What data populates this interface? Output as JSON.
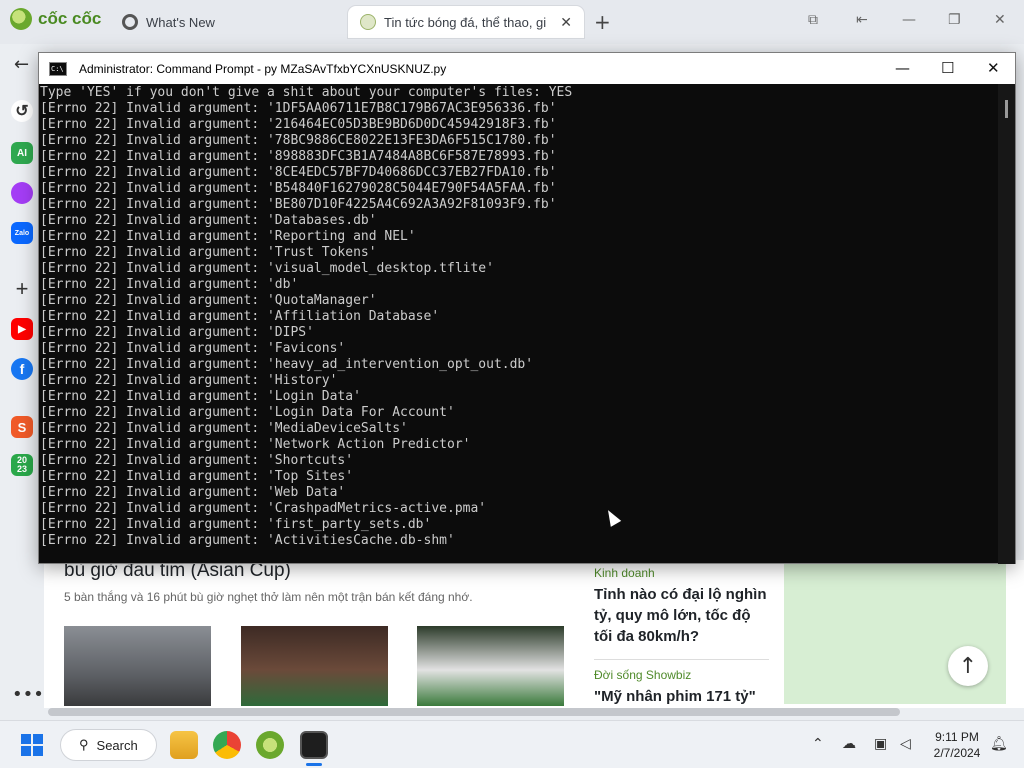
{
  "browser": {
    "logo_text": "cốc cốc",
    "tabs": [
      {
        "label": "What's New"
      },
      {
        "label": "Tin tức bóng đá, thể thao, gi"
      }
    ]
  },
  "page": {
    "headline": "bù giờ đau tim (Asian Cup)",
    "summary": "5 bàn thắng và 16 phút bù giờ nghẹt thở làm nên một trận bán kết đáng nhớ.",
    "right": [
      {
        "category": "Kinh doanh",
        "title": "Tỉnh nào có đại lộ nghìn tỷ, quy mô lớn, tốc độ tối đa 80km/h?"
      },
      {
        "category": "Đời sống Showbiz",
        "title": "\"Mỹ nhân phim 171 tỷ\""
      }
    ]
  },
  "cmd": {
    "title": "Administrator: Command Prompt - py  MZaSAvTfxbYCXnUSKNUZ.py",
    "lines": [
      "Type 'YES' if you don't give a shit about your computer's files: YES",
      "[Errno 22] Invalid argument: '1DF5AA06711E7B8C179B67AC3E956336.fb'",
      "[Errno 22] Invalid argument: '216464EC05D3BE9BD6D0DC45942918F3.fb'",
      "[Errno 22] Invalid argument: '78BC9886CE8022E13FE3DA6F515C1780.fb'",
      "[Errno 22] Invalid argument: '898883DFC3B1A7484A8BC6F587E78993.fb'",
      "[Errno 22] Invalid argument: '8CE4EDC57BF7D40686DCC37EB27FDA10.fb'",
      "[Errno 22] Invalid argument: 'B54840F16279028C5044E790F54A5FAA.fb'",
      "[Errno 22] Invalid argument: 'BE807D10F4225A4C692A3A92F81093F9.fb'",
      "[Errno 22] Invalid argument: 'Databases.db'",
      "[Errno 22] Invalid argument: 'Reporting and NEL'",
      "[Errno 22] Invalid argument: 'Trust Tokens'",
      "[Errno 22] Invalid argument: 'visual_model_desktop.tflite'",
      "[Errno 22] Invalid argument: 'db'",
      "[Errno 22] Invalid argument: 'QuotaManager'",
      "[Errno 22] Invalid argument: 'Affiliation Database'",
      "[Errno 22] Invalid argument: 'DIPS'",
      "[Errno 22] Invalid argument: 'Favicons'",
      "[Errno 22] Invalid argument: 'heavy_ad_intervention_opt_out.db'",
      "[Errno 22] Invalid argument: 'History'",
      "[Errno 22] Invalid argument: 'Login Data'",
      "[Errno 22] Invalid argument: 'Login Data For Account'",
      "[Errno 22] Invalid argument: 'MediaDeviceSalts'",
      "[Errno 22] Invalid argument: 'Network Action Predictor'",
      "[Errno 22] Invalid argument: 'Shortcuts'",
      "[Errno 22] Invalid argument: 'Top Sites'",
      "[Errno 22] Invalid argument: 'Web Data'",
      "[Errno 22] Invalid argument: 'CrashpadMetrics-active.pma'",
      "[Errno 22] Invalid argument: 'first_party_sets.db'",
      "[Errno 22] Invalid argument: 'ActivitiesCache.db-shm'"
    ]
  },
  "sidebar": {
    "ai_label": "AI",
    "zalo_label": "Zalo",
    "shopee_label": "S",
    "year_label": "20 23"
  },
  "taskbar": {
    "search_label": "Search",
    "time": "9:11 PM",
    "date": "2/7/2024"
  },
  "colors": {
    "console_bg": "#0c0c0c",
    "console_text": "#cccccc",
    "brand_green": "#4a8a22",
    "windows_blue": "#1a73e8"
  }
}
